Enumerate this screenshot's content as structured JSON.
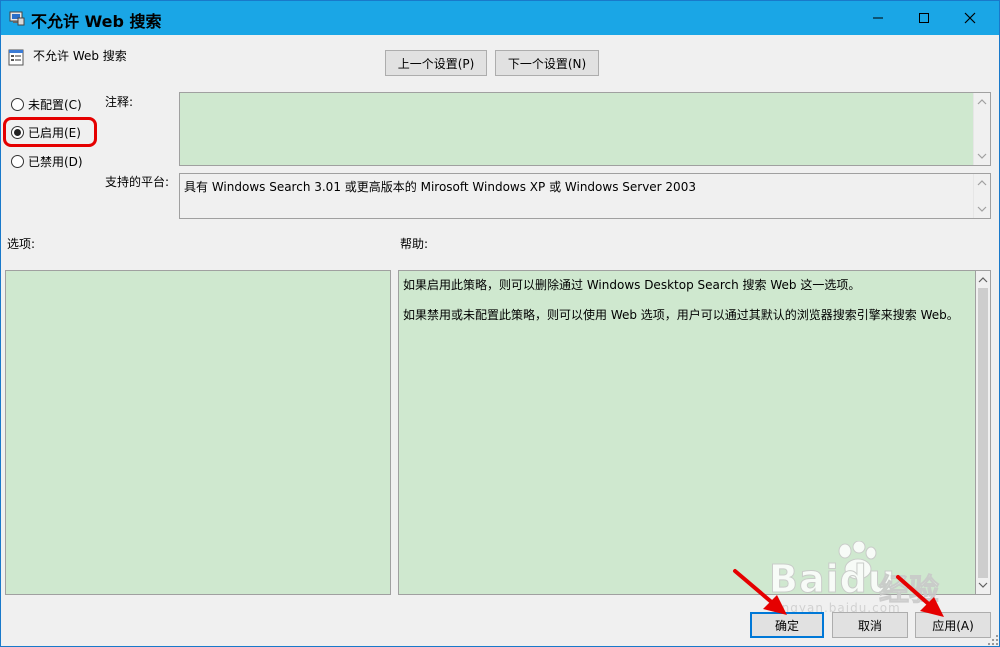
{
  "window": {
    "title": "不允许 Web 搜索"
  },
  "header": {
    "policy_name": "不允许 Web 搜索",
    "prev_button": "上一个设置(P)",
    "next_button": "下一个设置(N)"
  },
  "state": {
    "not_configured": "未配置(C)",
    "enabled": "已启用(E)",
    "disabled": "已禁用(D)",
    "selected": "enabled"
  },
  "labels": {
    "comment": "注释:",
    "platform": "支持的平台:",
    "options": "选项:",
    "help": "帮助:"
  },
  "platform_text": "具有 Windows Search 3.01 或更高版本的 Mirosoft Windows XP 或 Windows Server 2003",
  "help_text": {
    "p1": "如果启用此策略，则可以删除通过 Windows Desktop Search 搜索 Web 这一选项。",
    "p2": "如果禁用或未配置此策略，则可以使用 Web 选项，用户可以通过其默认的浏览器搜索引擎来搜索 Web。"
  },
  "footer": {
    "ok": "确定",
    "cancel": "取消",
    "apply": "应用(A)"
  },
  "watermark": {
    "brand": "Baidu",
    "cn": "经验",
    "url": "jingyan.baidu.com"
  },
  "colors": {
    "titlebar": "#1aa6e6",
    "field_green": "#cfe8cf",
    "highlight_red": "#e50000"
  }
}
